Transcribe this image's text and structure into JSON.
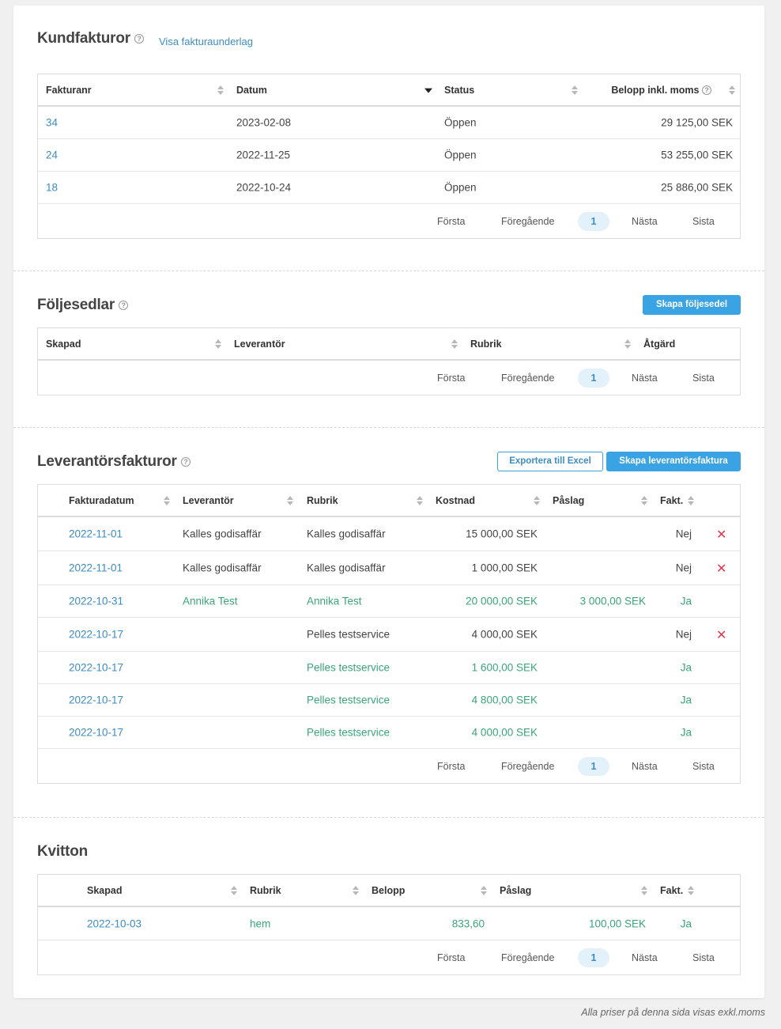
{
  "kundfakturor": {
    "title": "Kundfakturor",
    "help_glyph": "?",
    "link": "Visa fakturaunderlag",
    "headers": {
      "fakturanr": "Fakturanr",
      "datum": "Datum",
      "status": "Status",
      "belopp": "Belopp inkl. moms"
    },
    "rows": [
      {
        "fakturanr": "34",
        "datum": "2023-02-08",
        "status": "Öppen",
        "belopp": "29 125,00 SEK"
      },
      {
        "fakturanr": "24",
        "datum": "2022-11-25",
        "status": "Öppen",
        "belopp": "53 255,00 SEK"
      },
      {
        "fakturanr": "18",
        "datum": "2022-10-24",
        "status": "Öppen",
        "belopp": "25 886,00 SEK"
      }
    ]
  },
  "foljesedlar": {
    "title": "Följesedlar",
    "help_glyph": "?",
    "create_button": "Skapa följesedel",
    "headers": {
      "skapad": "Skapad",
      "leverantor": "Leverantör",
      "rubrik": "Rubrik",
      "atgard": "Åtgärd"
    }
  },
  "leverantorsfakturor": {
    "title": "Leverantörsfakturor",
    "help_glyph": "?",
    "export_button": "Exportera till Excel",
    "create_button": "Skapa leverantörsfaktura",
    "headers": {
      "fakturadatum": "Fakturadatum",
      "leverantor": "Leverantör",
      "rubrik": "Rubrik",
      "kostnad": "Kostnad",
      "paslag": "Påslag",
      "fakt": "Fakt."
    },
    "rows": [
      {
        "fakturadatum": "2022-11-01",
        "leverantor": "Kalles godisaffär",
        "rubrik": "Kalles godisaffär",
        "kostnad": "15 000,00 SEK",
        "paslag": "",
        "fakt": "Nej",
        "green": false,
        "delete": true
      },
      {
        "fakturadatum": "2022-11-01",
        "leverantor": "Kalles godisaffär",
        "rubrik": "Kalles godisaffär",
        "kostnad": "1 000,00 SEK",
        "paslag": "",
        "fakt": "Nej",
        "green": false,
        "delete": true
      },
      {
        "fakturadatum": "2022-10-31",
        "leverantor": "Annika Test",
        "rubrik": "Annika Test",
        "kostnad": "20 000,00 SEK",
        "paslag": "3 000,00 SEK",
        "fakt": "Ja",
        "green": true,
        "delete": false
      },
      {
        "fakturadatum": "2022-10-17",
        "leverantor": "",
        "rubrik": "Pelles testservice",
        "kostnad": "4 000,00 SEK",
        "paslag": "",
        "fakt": "Nej",
        "green": false,
        "delete": true
      },
      {
        "fakturadatum": "2022-10-17",
        "leverantor": "",
        "rubrik": "Pelles testservice",
        "kostnad": "1 600,00 SEK",
        "paslag": "",
        "fakt": "Ja",
        "green": true,
        "delete": false
      },
      {
        "fakturadatum": "2022-10-17",
        "leverantor": "",
        "rubrik": "Pelles testservice",
        "kostnad": "4 800,00 SEK",
        "paslag": "",
        "fakt": "Ja",
        "green": true,
        "delete": false
      },
      {
        "fakturadatum": "2022-10-17",
        "leverantor": "",
        "rubrik": "Pelles testservice",
        "kostnad": "4 000,00 SEK",
        "paslag": "",
        "fakt": "Ja",
        "green": true,
        "delete": false
      }
    ]
  },
  "kvitton": {
    "title": "Kvitton",
    "headers": {
      "skapad": "Skapad",
      "rubrik": "Rubrik",
      "belopp": "Belopp",
      "paslag": "Påslag",
      "fakt": "Fakt."
    },
    "rows": [
      {
        "skapad": "2022-10-03",
        "rubrik": "hem",
        "belopp": "833,60",
        "paslag": "100,00 SEK",
        "fakt": "Ja"
      }
    ]
  },
  "pager": {
    "first": "Första",
    "prev": "Föregående",
    "page": "1",
    "next": "Nästa",
    "last": "Sista"
  },
  "delete_glyph": "✕",
  "footnote": "Alla priser på denna sida visas exkl.moms",
  "colors": {
    "link": "#3d8cc4",
    "green": "#3aa57a",
    "primary_button": "#3aa3e3",
    "delete": "#e0384e"
  }
}
